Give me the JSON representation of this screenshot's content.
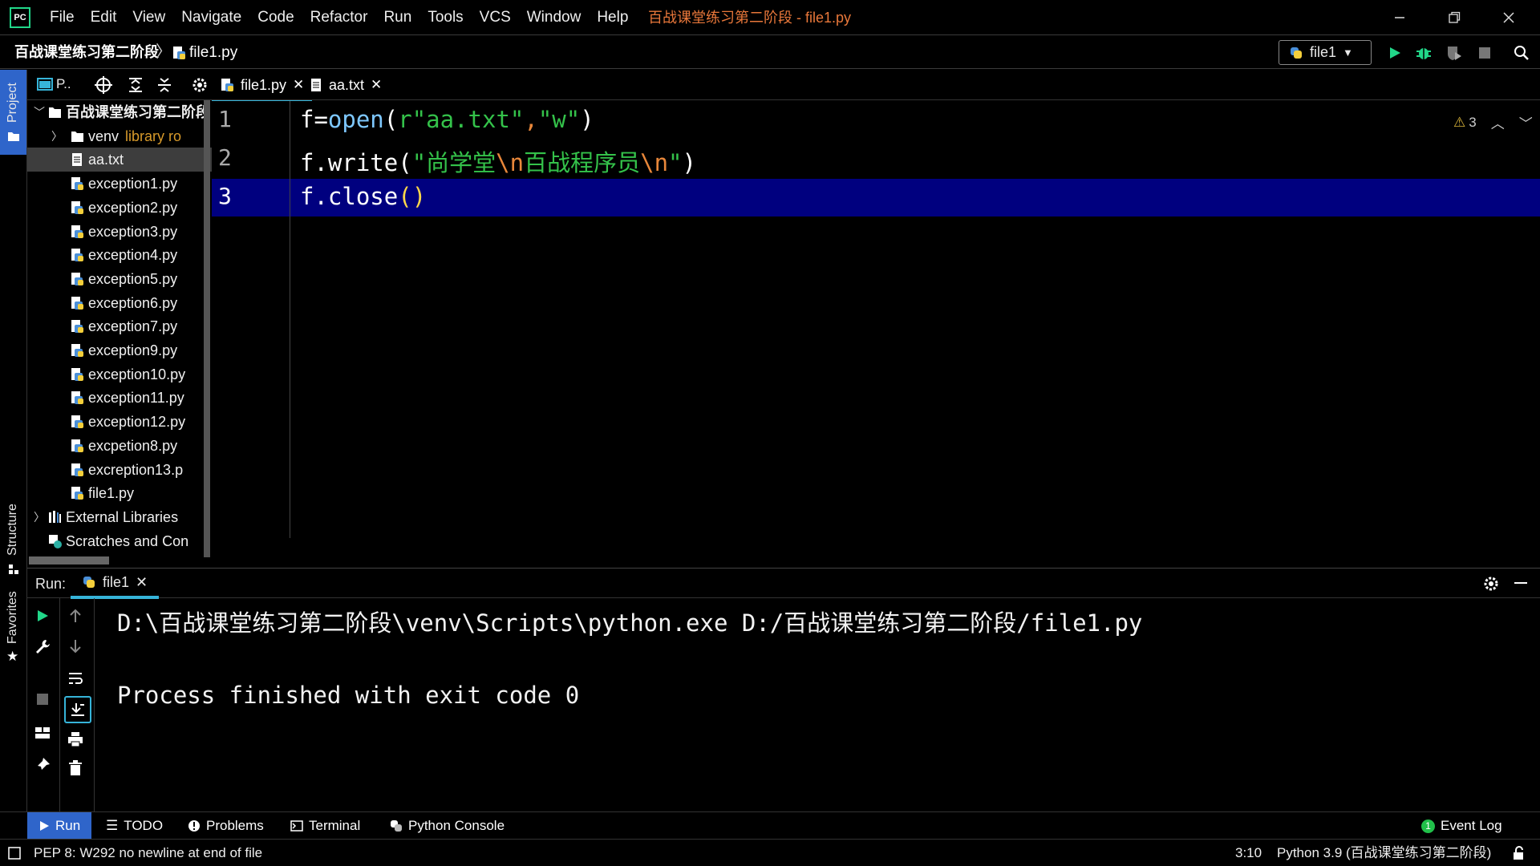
{
  "app": {
    "logo_text": "PC",
    "window_title": "百战课堂练习第二阶段 - file1.py",
    "menu": [
      "File",
      "Edit",
      "View",
      "Navigate",
      "Code",
      "Refactor",
      "Run",
      "Tools",
      "VCS",
      "Window",
      "Help"
    ]
  },
  "navbar": {
    "project": "百战课堂练习第二阶段",
    "separator": "〉",
    "file": "file1.py",
    "run_config": "file1"
  },
  "left_strip": {
    "project_label": "Project",
    "structure_label": "Structure",
    "favorites_label": "Favorites"
  },
  "project_panel": {
    "view_selector": "P..",
    "tree": [
      {
        "label": "百战课堂练习第二阶段",
        "type": "folder",
        "expanded": true,
        "level": 0
      },
      {
        "label": "venv",
        "suffix": "library ro",
        "type": "folder",
        "expanded": false,
        "level": 1
      },
      {
        "label": "aa.txt",
        "type": "text",
        "level": 1,
        "selected": true
      },
      {
        "label": "exception1.py",
        "type": "python",
        "level": 1
      },
      {
        "label": "exception2.py",
        "type": "python",
        "level": 1
      },
      {
        "label": "exception3.py",
        "type": "python",
        "level": 1
      },
      {
        "label": "exception4.py",
        "type": "python",
        "level": 1
      },
      {
        "label": "exception5.py",
        "type": "python",
        "level": 1
      },
      {
        "label": "exception6.py",
        "type": "python",
        "level": 1
      },
      {
        "label": "exception7.py",
        "type": "python",
        "level": 1
      },
      {
        "label": "exception9.py",
        "type": "python",
        "level": 1
      },
      {
        "label": "exception10.py",
        "type": "python",
        "level": 1
      },
      {
        "label": "exception11.py",
        "type": "python",
        "level": 1
      },
      {
        "label": "exception12.py",
        "type": "python",
        "level": 1
      },
      {
        "label": "excpetion8.py",
        "type": "python",
        "level": 1
      },
      {
        "label": "excreption13.p",
        "type": "python",
        "level": 1
      },
      {
        "label": "file1.py",
        "type": "python",
        "level": 1
      },
      {
        "label": "External Libraries",
        "type": "libraries",
        "expanded": false,
        "level": 0
      },
      {
        "label": "Scratches and Con",
        "type": "scratches",
        "level": 0
      }
    ]
  },
  "editor": {
    "tabs": [
      {
        "label": "file1.py",
        "active": true
      },
      {
        "label": "aa.txt",
        "active": false
      }
    ],
    "line_numbers": [
      "1",
      "2",
      "3"
    ],
    "code": {
      "l1": {
        "var": "f=",
        "fn": "open",
        "open": "(",
        "str1": "r\"aa.txt\"",
        "comma": ",",
        "str2": "\"w\"",
        "close": ")"
      },
      "l2": {
        "obj": "f.",
        "fn": "write",
        "open": "(",
        "s1": "\"尚学堂",
        "e1": "\\n",
        "s2": "百战程序员",
        "e2": "\\n",
        "s3": "\"",
        "close": ")"
      },
      "l3": {
        "obj": "f.",
        "fn": "close",
        "paren": "()"
      }
    },
    "warning_count": "3",
    "current_line": 3
  },
  "run_window": {
    "label": "Run:",
    "tab": "file1",
    "output": [
      "D:\\百战课堂练习第二阶段\\venv\\Scripts\\python.exe D:/百战课堂练习第二阶段/file1.py",
      "",
      "Process finished with exit code 0"
    ]
  },
  "bottom_tabs": [
    {
      "label": "Run",
      "icon": "play-icon",
      "active": true
    },
    {
      "label": "TODO",
      "icon": "list-icon"
    },
    {
      "label": "Problems",
      "icon": "info-icon"
    },
    {
      "label": "Terminal",
      "icon": "terminal-icon"
    },
    {
      "label": "Python Console",
      "icon": "python-icon"
    }
  ],
  "event_log": {
    "label": "Event Log",
    "badge": "1"
  },
  "status": {
    "message": "PEP 8: W292 no newline at end of file",
    "position": "3:10",
    "interpreter": "Python 3.9 (百战课堂练习第二阶段)"
  },
  "colors": {
    "accent": "#36b4d9",
    "selection_blue": "#2f65ca",
    "current_line": "#00007f",
    "string_green": "#34c24a",
    "escape_orange": "#e8873a",
    "function_blue": "#7ec8ff",
    "run_green": "#21d789"
  }
}
